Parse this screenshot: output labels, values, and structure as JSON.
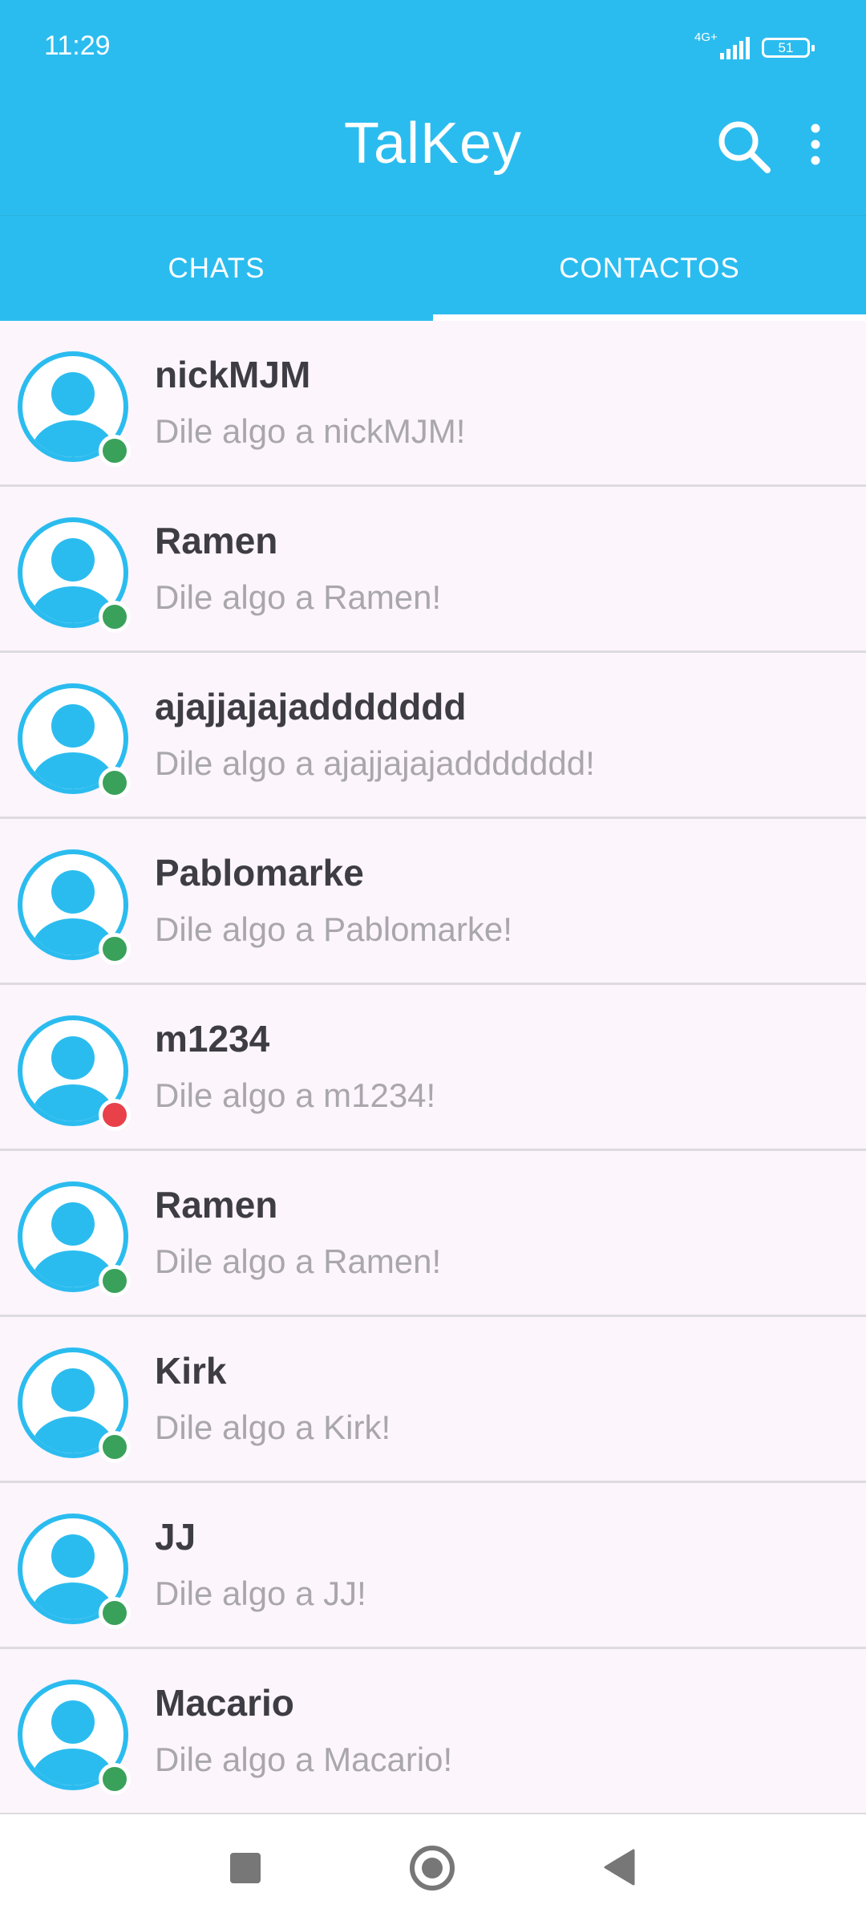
{
  "status": {
    "time": "11:29",
    "network": "4G+",
    "battery": "51"
  },
  "app": {
    "title": "TalKey"
  },
  "tabs": [
    {
      "label": "CHATS",
      "selected": false
    },
    {
      "label": "CONTACTOS",
      "selected": true
    }
  ],
  "contacts": [
    {
      "name": "nickMJM",
      "message": "Dile algo a nickMJM!",
      "status": "online"
    },
    {
      "name": "Ramen",
      "message": "Dile algo a Ramen!",
      "status": "online"
    },
    {
      "name": "ajajjajajaddddddd",
      "message": "Dile algo a ajajjajajaddddddd!",
      "status": "online"
    },
    {
      "name": "Pablomarke",
      "message": "Dile algo a Pablomarke!",
      "status": "online"
    },
    {
      "name": "m1234",
      "message": "Dile algo a m1234!",
      "status": "offline"
    },
    {
      "name": "Ramen",
      "message": "Dile algo a Ramen!",
      "status": "online"
    },
    {
      "name": "Kirk",
      "message": "Dile algo a Kirk!",
      "status": "online"
    },
    {
      "name": "JJ",
      "message": "Dile algo a JJ!",
      "status": "online"
    },
    {
      "name": "Macario",
      "message": "Dile algo a Macario!",
      "status": "online"
    }
  ],
  "colors": {
    "primary": "#2bbcef",
    "online": "#3aa15a",
    "offline": "#e8414a"
  },
  "icons": {
    "search": "search-icon",
    "menu": "more-vert-icon",
    "avatar": "person-avatar-icon",
    "nav_recents": "square-icon",
    "nav_home": "circle-icon",
    "nav_back": "triangle-back-icon"
  }
}
